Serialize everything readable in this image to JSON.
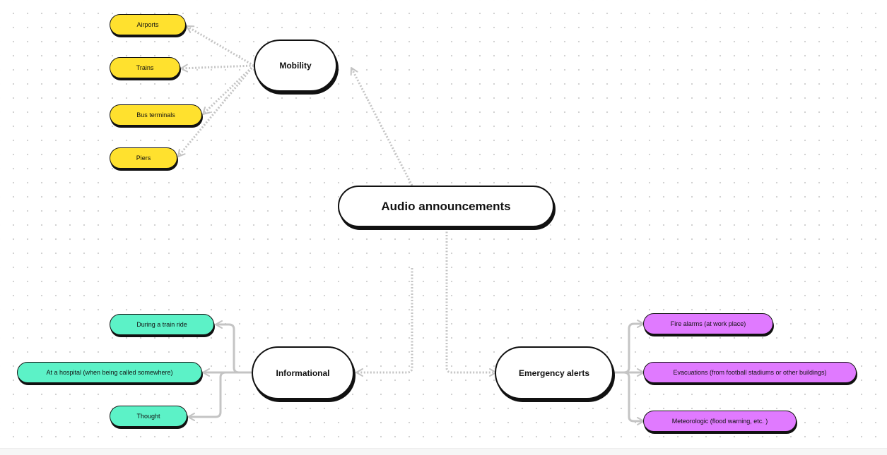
{
  "diagram": {
    "central": {
      "label": "Audio announcements"
    },
    "mobility": {
      "label": "Mobility",
      "items": [
        "Airports",
        "Trains",
        "Bus terminals",
        "Piers"
      ]
    },
    "informational": {
      "label": "Informational",
      "items": [
        "During a train ride",
        "At a hospital (when being called somewhere)",
        "Thought"
      ]
    },
    "emergency": {
      "label": "Emergency alerts",
      "items": [
        "Fire alarms (at work place)",
        "Evacuations (from football stadiums or other buildings)",
        "Meteorologic (flood warning, etc. )"
      ]
    }
  },
  "colors": {
    "mobility_fill": "#ffe12e",
    "informational_fill": "#5cf2c7",
    "emergency_fill": "#e07aff",
    "connector": "#c4c4c4",
    "outline": "#111111"
  }
}
